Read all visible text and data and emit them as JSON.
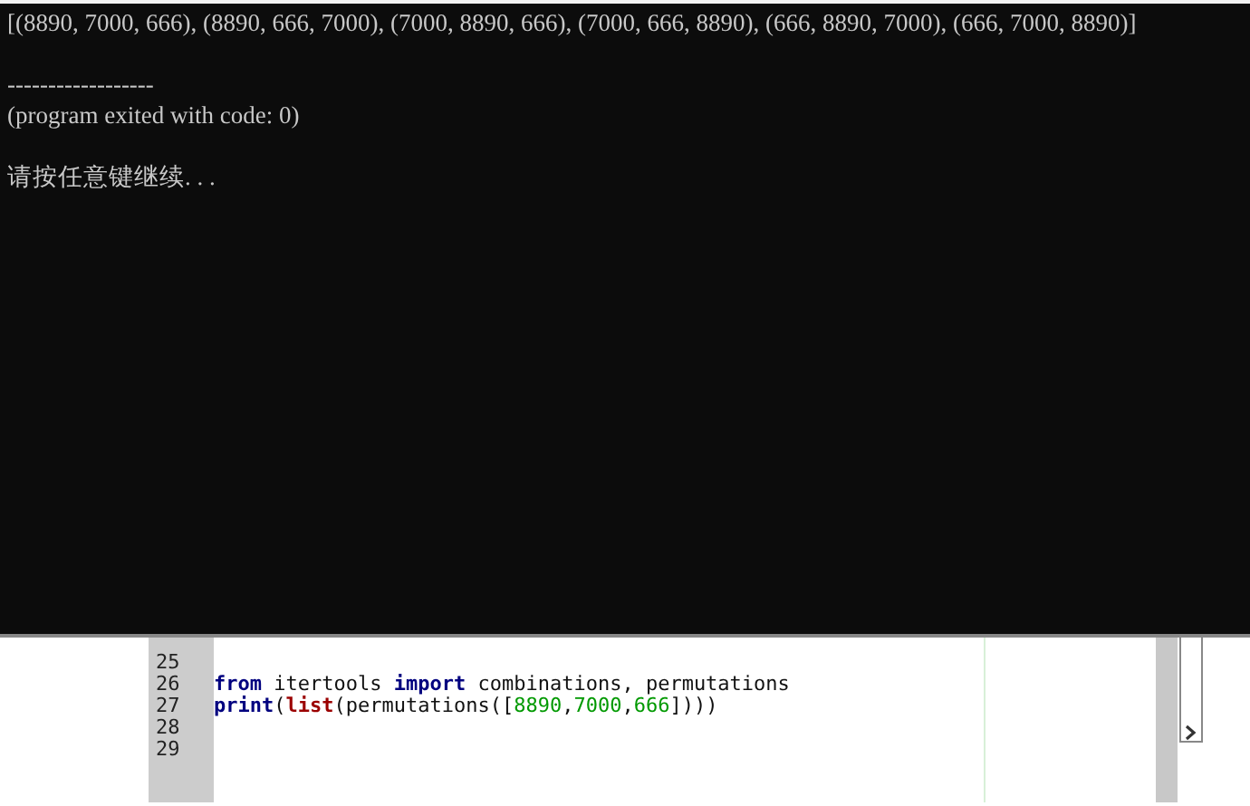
{
  "console": {
    "output": "[(8890, 7000, 666), (8890, 666, 7000), (7000, 8890, 666), (7000, 666, 8890), (666, 8890, 7000), (666, 7000, 8890)]",
    "separator": "------------------",
    "exit_message": "(program exited with code: 0)",
    "prompt": "请按任意键继续. . ."
  },
  "editor": {
    "lines": [
      {
        "number": "25"
      },
      {
        "number": "26",
        "tokens": [
          {
            "kind": "keyword",
            "text": "from"
          },
          {
            "kind": "plain",
            "text": " itertools "
          },
          {
            "kind": "keyword",
            "text": "import"
          },
          {
            "kind": "plain",
            "text": " combinations, permutations"
          }
        ]
      },
      {
        "number": "27",
        "tokens": [
          {
            "kind": "keyword",
            "text": "print"
          },
          {
            "kind": "plain",
            "text": "("
          },
          {
            "kind": "builtin",
            "text": "list"
          },
          {
            "kind": "plain",
            "text": "(permutations(["
          },
          {
            "kind": "number",
            "text": "8890"
          },
          {
            "kind": "plain",
            "text": ","
          },
          {
            "kind": "number",
            "text": "7000"
          },
          {
            "kind": "plain",
            "text": ","
          },
          {
            "kind": "number",
            "text": "666"
          },
          {
            "kind": "plain",
            "text": "])))"
          }
        ]
      },
      {
        "number": "28"
      },
      {
        "number": "29"
      }
    ]
  }
}
